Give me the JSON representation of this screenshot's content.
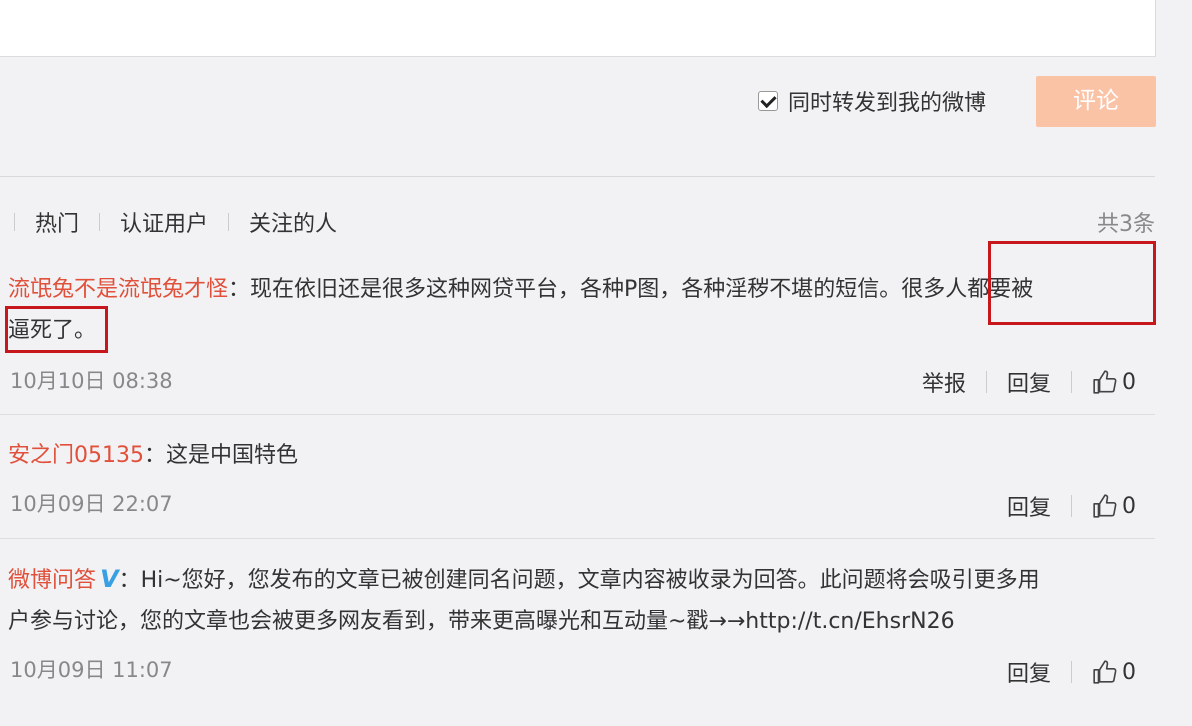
{
  "composer": {
    "forward_label": "同时转发到我的微博",
    "forward_checked": true,
    "submit_label": "评论"
  },
  "tabs": {
    "items": [
      "热门",
      "认证用户",
      "关注的人"
    ],
    "total": "共3条"
  },
  "comments": [
    {
      "user": "流氓兔不是流氓兔才怪",
      "text_1": "：现在依旧还是很多这种网贷平台，各种P图，各种淫秽不堪的短信。很多人都要被",
      "text_2": "逼死了。",
      "time": "10月10日 08:38",
      "report": "举报",
      "reply": "回复",
      "likes": "0"
    },
    {
      "user": "安之门05135",
      "text_1": "：这是中国特色",
      "time": "10月09日 22:07",
      "reply": "回复",
      "likes": "0"
    },
    {
      "user": "微博问答",
      "badge": "V",
      "text_1": "：Hi~您好，您发布的文章已被创建同名问题，文章内容被收录为回答。此问题将会吸引更多用",
      "text_2": "户参与讨论，您的文章也会被更多网友看到，带来更高曝光和互动量~戳→→http://t.cn/EhsrN26",
      "time": "10月09日 11:07",
      "reply": "回复",
      "likes": "0"
    }
  ],
  "colors": {
    "username": "#e0503a",
    "submit_bg": "#fbc3a6",
    "highlight": "#c8161d",
    "badge": "#39a0e3"
  }
}
